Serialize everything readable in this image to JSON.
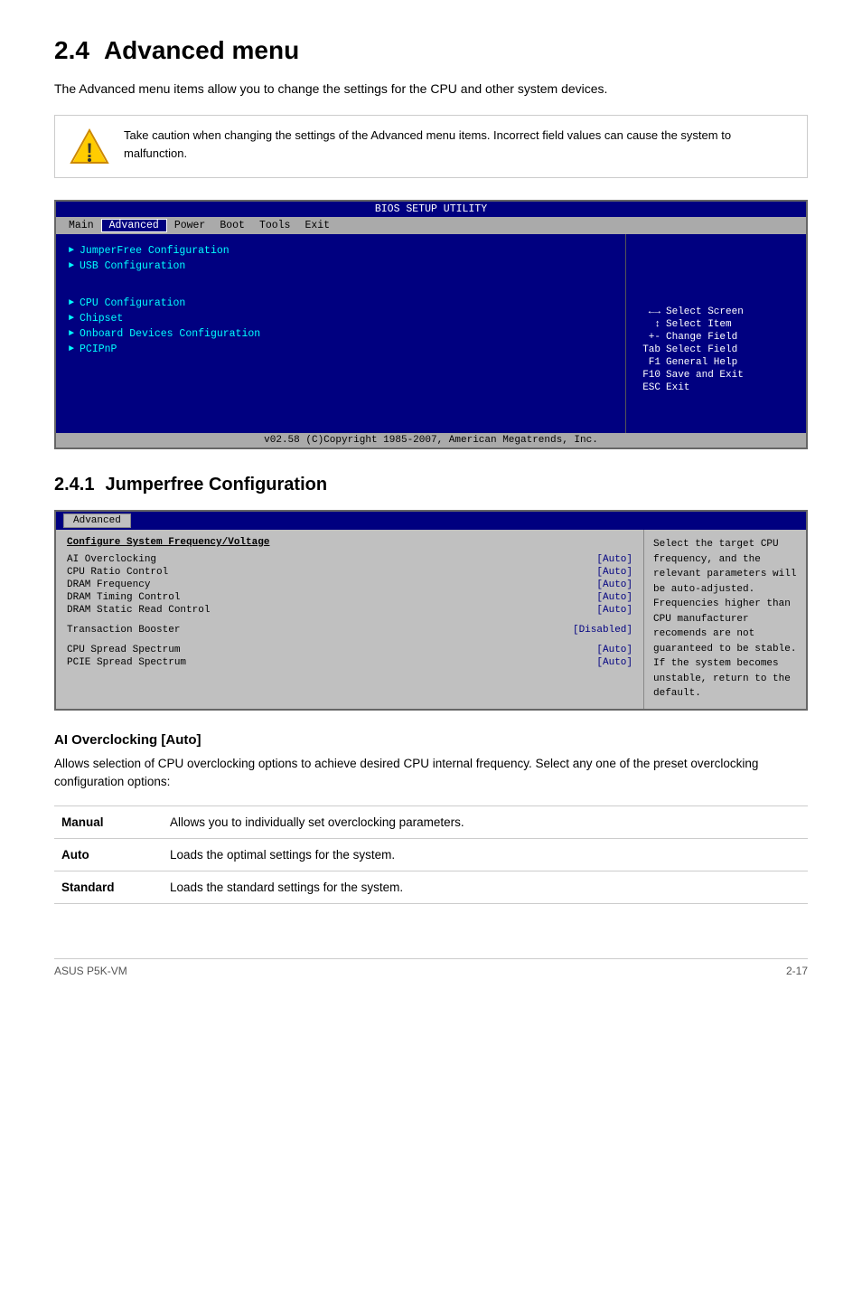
{
  "page": {
    "footer_left": "ASUS P5K-VM",
    "footer_right": "2-17"
  },
  "section": {
    "number": "2.4",
    "title": "Advanced menu",
    "intro": "The Advanced menu items allow you to change the settings for the CPU and other system devices."
  },
  "warning": {
    "text": "Take caution when changing the settings of the Advanced menu items. Incorrect field values can cause the system to malfunction."
  },
  "bios1": {
    "title": "BIOS SETUP UTILITY",
    "nav_items": [
      "Main",
      "Advanced",
      "Power",
      "Boot",
      "Tools",
      "Exit"
    ],
    "active_nav": "Advanced",
    "menu_items_group1": [
      "JumperFree Configuration",
      "USB Configuration"
    ],
    "menu_items_group2": [
      "CPU Configuration",
      "Chipset",
      "Onboard Devices Configuration",
      "PCIPnP"
    ],
    "sidebar_keys": [
      {
        "key": "←→",
        "desc": "Select Screen"
      },
      {
        "key": "↑↓",
        "desc": "Select Item"
      },
      {
        "key": "+-",
        "desc": "Change Field"
      },
      {
        "key": "Tab",
        "desc": "Select Field"
      },
      {
        "key": "F1",
        "desc": "General Help"
      },
      {
        "key": "F10",
        "desc": "Save and Exit"
      },
      {
        "key": "ESC",
        "desc": "Exit"
      }
    ],
    "footer": "v02.58  (C)Copyright 1985-2007, American Megatrends, Inc."
  },
  "subsection": {
    "number": "2.4.1",
    "title": "Jumperfree Configuration"
  },
  "bios2": {
    "tab": "Advanced",
    "section_header": "Configure System Frequency/Voltage",
    "rows": [
      {
        "label": "AI Overclocking",
        "value": "[Auto]"
      },
      {
        "label": "CPU Ratio Control",
        "value": "[Auto]"
      },
      {
        "label": "DRAM Frequency",
        "value": "[Auto]"
      },
      {
        "label": "DRAM Timing Control",
        "value": "[Auto]"
      },
      {
        "label": "DRAM Static Read Control",
        "value": "[Auto]"
      },
      {
        "label": "",
        "value": ""
      },
      {
        "label": "Transaction Booster",
        "value": "[Disabled]"
      },
      {
        "label": "",
        "value": ""
      },
      {
        "label": "CPU Spread Spectrum",
        "value": "[Auto]"
      },
      {
        "label": "PCIE Spread Spectrum",
        "value": "[Auto]"
      }
    ],
    "sidebar_text": "Select the target CPU frequency, and the relevant parameters will be auto-adjusted. Frequencies higher than CPU manufacturer recomends are not guaranteed to be stable. If the system becomes unstable, return to the default."
  },
  "ai_overclocking": {
    "title": "AI Overclocking [Auto]",
    "desc": "Allows selection of CPU overclocking options to achieve desired CPU internal frequency. Select any one of the preset overclocking configuration options:",
    "options": [
      {
        "name": "Manual",
        "desc": "Allows you to individually set overclocking parameters."
      },
      {
        "name": "Auto",
        "desc": "Loads the optimal settings for the system."
      },
      {
        "name": "Standard",
        "desc": "Loads the standard settings for the system."
      }
    ]
  }
}
